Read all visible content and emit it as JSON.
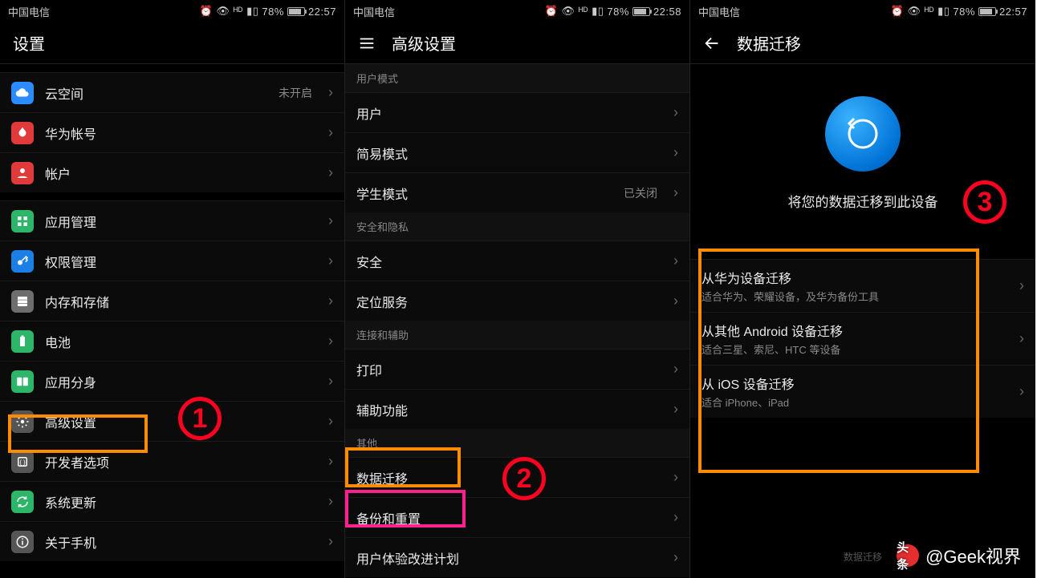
{
  "status": {
    "carrier": "中国电信",
    "battery_percent": "78%",
    "icons_text": "⏰ 👁 ⇆ ᴴᴰ",
    "signal_text": "▮▯▯"
  },
  "screen1": {
    "time": "22:57",
    "title": "设置",
    "rows": [
      {
        "icon": "ic-cloud",
        "name": "cloud",
        "label": "云空间",
        "value": "未开启"
      },
      {
        "icon": "ic-huawei",
        "name": "huawei-id",
        "label": "华为帐号"
      },
      {
        "icon": "ic-account",
        "name": "accounts",
        "label": "帐户"
      },
      {
        "sep": true
      },
      {
        "icon": "ic-apps",
        "name": "app-management",
        "label": "应用管理"
      },
      {
        "icon": "ic-key",
        "name": "permission-mgmt",
        "label": "权限管理"
      },
      {
        "icon": "ic-storage",
        "name": "storage",
        "label": "内存和存储"
      },
      {
        "icon": "ic-battery",
        "name": "battery",
        "label": "电池"
      },
      {
        "icon": "ic-twin",
        "name": "app-twin",
        "label": "应用分身"
      },
      {
        "icon": "ic-gear",
        "name": "advanced-settings",
        "label": "高级设置"
      },
      {
        "icon": "ic-dev",
        "name": "developer-options",
        "label": "开发者选项"
      },
      {
        "icon": "ic-update",
        "name": "system-update",
        "label": "系统更新"
      },
      {
        "icon": "ic-about",
        "name": "about-phone",
        "label": "关于手机"
      }
    ]
  },
  "screen2": {
    "time": "22:58",
    "title": "高级设置",
    "groups": [
      {
        "header": "用户模式",
        "rows": [
          {
            "name": "users",
            "label": "用户"
          },
          {
            "name": "simple-mode",
            "label": "简易模式"
          },
          {
            "name": "student-mode",
            "label": "学生模式",
            "value": "已关闭"
          }
        ]
      },
      {
        "header": "安全和隐私",
        "rows": [
          {
            "name": "security",
            "label": "安全"
          },
          {
            "name": "location",
            "label": "定位服务"
          }
        ]
      },
      {
        "header": "连接和辅助",
        "rows": [
          {
            "name": "printing",
            "label": "打印"
          },
          {
            "name": "accessibility",
            "label": "辅助功能"
          }
        ]
      },
      {
        "header": "其他",
        "rows": [
          {
            "name": "data-migration",
            "label": "数据迁移"
          },
          {
            "name": "backup-reset",
            "label": "备份和重置"
          },
          {
            "name": "ux-improvement",
            "label": "用户体验改进计划"
          }
        ]
      }
    ]
  },
  "screen3": {
    "time": "22:57",
    "title": "数据迁移",
    "subtitle": "将您的数据迁移到此设备",
    "options": [
      {
        "name": "from-huawei",
        "t1": "从华为设备迁移",
        "t2": "适合华为、荣耀设备，及华为备份工具"
      },
      {
        "name": "from-android",
        "t1": "从其他 Android 设备迁移",
        "t2": "适合三星、索尼、HTC 等设备"
      },
      {
        "name": "from-ios",
        "t1": "从 iOS 设备迁移",
        "t2": "适合 iPhone、iPad"
      }
    ],
    "footer_hint": "数据迁移"
  },
  "annotations": {
    "step1": "1",
    "step2": "2",
    "step3": "3"
  },
  "watermark": {
    "logo_text": "头条",
    "text": "@Geek视界"
  }
}
